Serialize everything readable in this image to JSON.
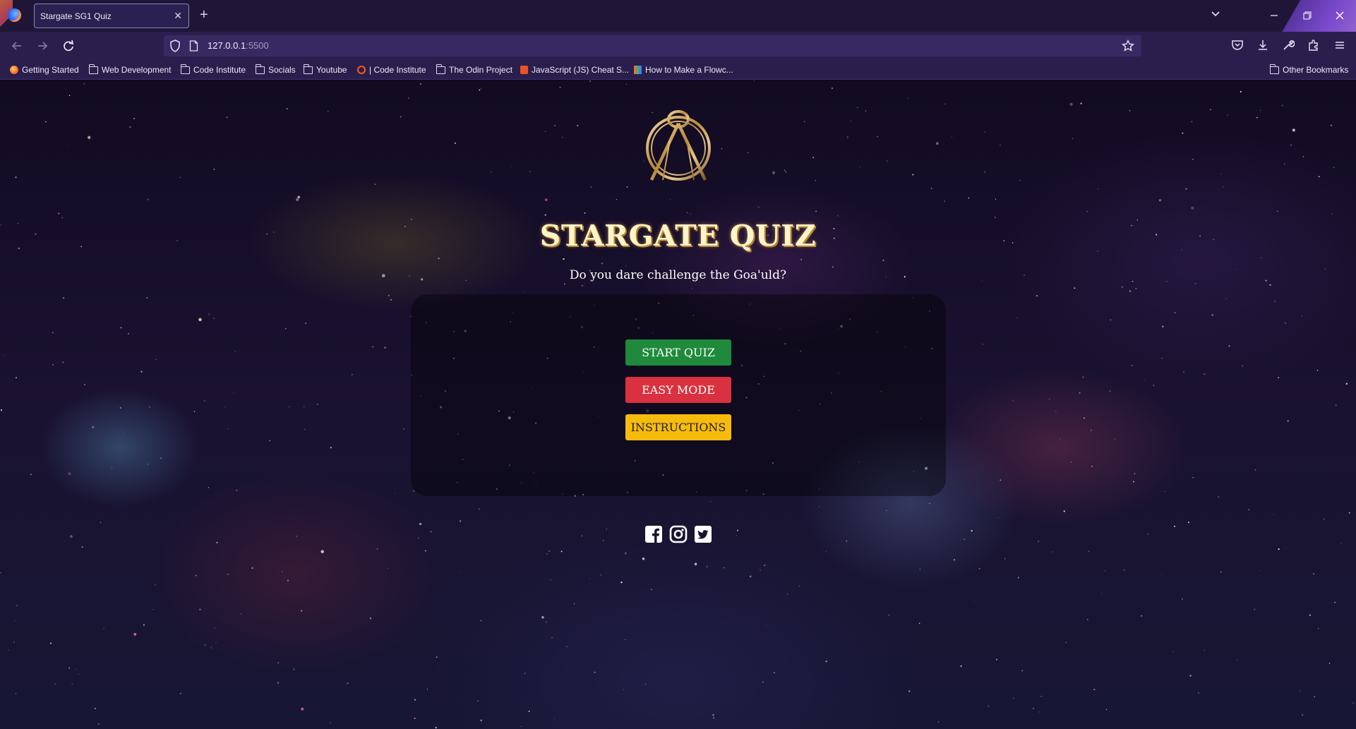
{
  "browser": {
    "tab_title": "Stargate SG1 Quiz",
    "tab_close": "✕",
    "new_tab": "+",
    "url_host": "127.0.0.1",
    "url_port": ":5500",
    "bookmarks": [
      {
        "label": "Getting Started",
        "icon": "firefox-icon"
      },
      {
        "label": "Web Development",
        "icon": "folder-icon"
      },
      {
        "label": "Code Institute",
        "icon": "folder-icon"
      },
      {
        "label": "Socials",
        "icon": "folder-icon"
      },
      {
        "label": "Youtube",
        "icon": "folder-icon"
      },
      {
        "label": "| Code Institute",
        "icon": "code-institute-icon"
      },
      {
        "label": "The Odin Project",
        "icon": "folder-icon"
      },
      {
        "label": "JavaScript (JS) Cheat S...",
        "icon": "js-cheatsheet-icon"
      },
      {
        "label": "How to Make a Flowc...",
        "icon": "flowchart-icon"
      }
    ],
    "other_bookmarks": "Other Bookmarks"
  },
  "page": {
    "title": "STARGATE QUIZ",
    "subtitle": "Do you dare challenge the Goa'uld?",
    "buttons": {
      "start": "START QUIZ",
      "easy": "EASY MODE",
      "instructions": "INSTRUCTIONS"
    },
    "socials": [
      "facebook-icon",
      "instagram-icon",
      "twitter-icon"
    ]
  },
  "colors": {
    "start": "#1f8a3b",
    "easy": "#d9313f",
    "instructions": "#f7bb0c",
    "title_gold": "#b8862b",
    "browser_frame": "#1f1537"
  }
}
